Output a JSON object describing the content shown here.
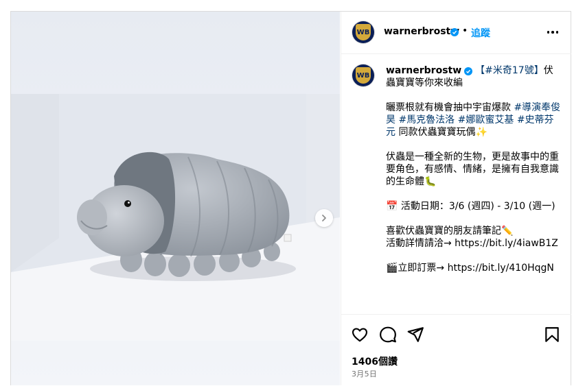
{
  "account": {
    "username": "warnerbrostw",
    "avatar_text": "WB",
    "verified_icon": "verified-check-icon",
    "separator": "•",
    "follow_label": "追蹤"
  },
  "caption": {
    "username": "warnerbrostw",
    "line1_tag": "【#米奇17號】",
    "line1_rest": "伏蟲寶寶等你來收編",
    "p2_start": "曬票根就有機會抽中宇宙爆款 ",
    "p2_tag1": "#導演奉俊昊",
    "p2_sp1": " ",
    "p2_tag2": "#馬克魯法洛",
    "p2_sp2": " ",
    "p2_tag3": "#娜歐蜜艾基",
    "p2_sp3": " ",
    "p2_tag4": "#史蒂芬元",
    "p2_end": " 同款伏蟲寶寶玩偶✨",
    "p3": "伏蟲是一種全新的生物，更是故事中的重要角色，有感情、情緒，是擁有自我意識的生命體🐛",
    "p4": "📅 活動日期：3/6 (週四) - 3/10 (週一)",
    "p5": "喜歡伏蟲寶寶的朋友請筆記✏️\n活動詳情請洽→ https://bit.ly/4iawB1Z",
    "p6": "🎬立即訂票→ https://bit.ly/410HqgN"
  },
  "stats": {
    "likes": "1406個讚",
    "date": "3月5日"
  },
  "icons": {
    "like": "heart-icon",
    "comment": "comment-icon",
    "share": "share-icon",
    "save": "bookmark-icon",
    "more": "more-options-icon",
    "next": "chevron-right-icon"
  },
  "colors": {
    "accent": "#0095f6",
    "hashtag": "#00376b",
    "avatar_bg": "#0b1f57",
    "avatar_shield": "#d4a93a"
  }
}
